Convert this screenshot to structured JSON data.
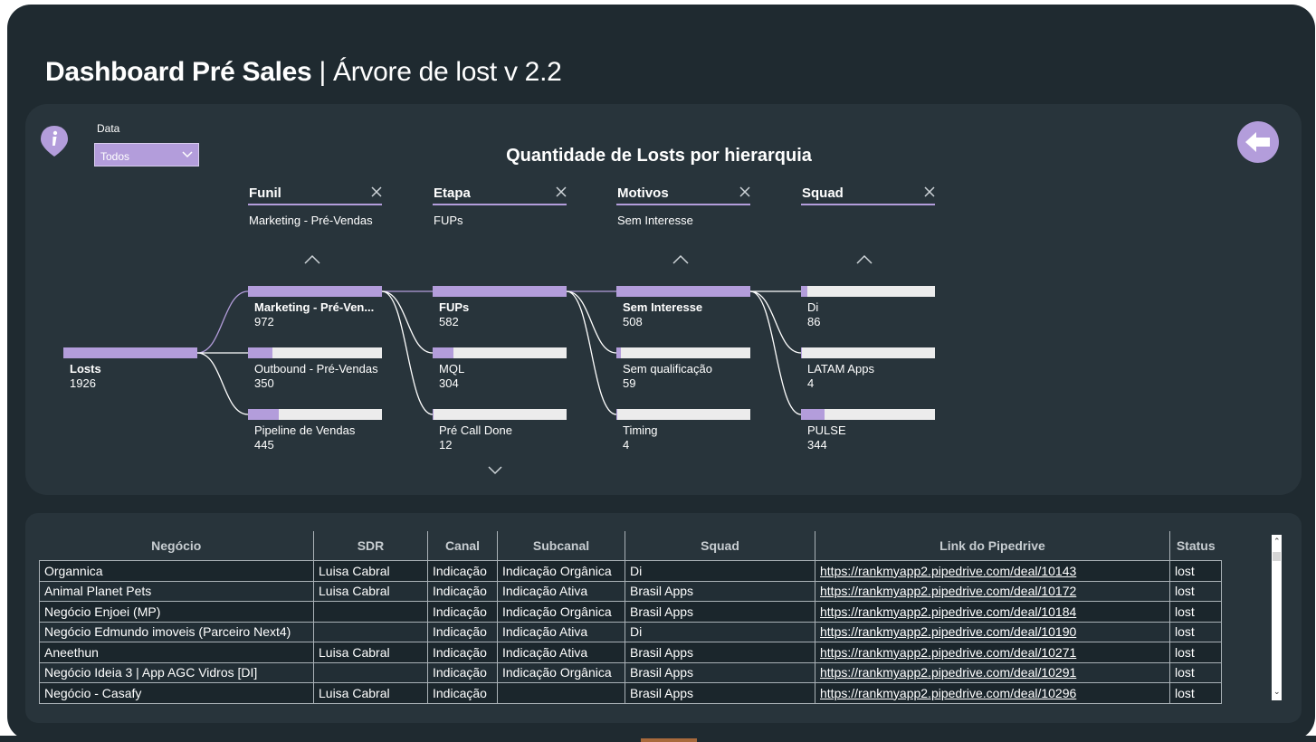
{
  "header": {
    "title_bold": "Dashboard Pré Sales",
    "separator": "|",
    "title_sub": "Árvore de lost v 2.2"
  },
  "filter": {
    "label": "Data",
    "value": "Todos"
  },
  "tree": {
    "title": "Quantidade de Losts por hierarquia",
    "root": {
      "label": "Losts",
      "value": 1926
    },
    "levels": [
      {
        "name": "Funil",
        "selected": "Marketing - Pré-Vendas",
        "nodes": [
          {
            "label": "Marketing - Pré-Ven...",
            "value": 972,
            "bold": true
          },
          {
            "label": "Outbound - Pré-Vendas",
            "value": 350
          },
          {
            "label": "Pipeline de Vendas",
            "value": 445
          }
        ]
      },
      {
        "name": "Etapa",
        "selected": "FUPs",
        "nodes": [
          {
            "label": "FUPs",
            "value": 582,
            "bold": true
          },
          {
            "label": "MQL",
            "value": 304
          },
          {
            "label": "Pré Call Done",
            "value": 12
          }
        ]
      },
      {
        "name": "Motivos",
        "selected": "Sem Interesse",
        "nodes": [
          {
            "label": "Sem Interesse",
            "value": 508,
            "bold": true
          },
          {
            "label": "Sem qualificação",
            "value": 59
          },
          {
            "label": "Timing",
            "value": 4
          }
        ]
      },
      {
        "name": "Squad",
        "selected": "",
        "nodes": [
          {
            "label": "Di",
            "value": 86
          },
          {
            "label": "LATAM Apps",
            "value": 4
          },
          {
            "label": "PULSE",
            "value": 344
          }
        ]
      }
    ]
  },
  "table": {
    "columns": [
      "Negócio",
      "SDR",
      "Canal",
      "Subcanal",
      "Squad",
      "Link do Pipedrive",
      "Status"
    ],
    "rows": [
      [
        "Organnica",
        "Luisa Cabral",
        "Indicação",
        "Indicação Orgânica",
        "Di",
        "https://rankmyapp2.pipedrive.com/deal/10143",
        "lost"
      ],
      [
        "Animal Planet Pets",
        "Luisa Cabral",
        "Indicação",
        "Indicação Ativa",
        "Brasil Apps",
        "https://rankmyapp2.pipedrive.com/deal/10172",
        "lost"
      ],
      [
        "Negócio Enjoei (MP)",
        "",
        "Indicação",
        "Indicação Orgânica",
        "Brasil Apps",
        "https://rankmyapp2.pipedrive.com/deal/10184",
        "lost"
      ],
      [
        "Negócio Edmundo imoveis (Parceiro Next4)",
        "",
        "Indicação",
        "Indicação Ativa",
        "Di",
        "https://rankmyapp2.pipedrive.com/deal/10190",
        "lost"
      ],
      [
        "Aneethun",
        "Luisa Cabral",
        "Indicação",
        "Indicação Ativa",
        "Brasil Apps",
        "https://rankmyapp2.pipedrive.com/deal/10271",
        "lost"
      ],
      [
        "Negócio Ideia 3 | App AGC Vidros [DI]",
        "",
        "Indicação",
        "Indicação Orgânica",
        "Brasil Apps",
        "https://rankmyapp2.pipedrive.com/deal/10291",
        "lost"
      ],
      [
        "Negócio - Casafy",
        "Luisa Cabral",
        "Indicação",
        "",
        "Brasil Apps",
        "https://rankmyapp2.pipedrive.com/deal/10296",
        "lost"
      ]
    ]
  },
  "colors": {
    "background": "#1f2a30",
    "panel": "#28343b",
    "accent": "#b39ddb",
    "bar_track": "#ececec"
  },
  "icons": [
    "info-icon",
    "chevron-down-icon",
    "back-arrow-icon",
    "close-icon",
    "chevron-up-icon"
  ]
}
